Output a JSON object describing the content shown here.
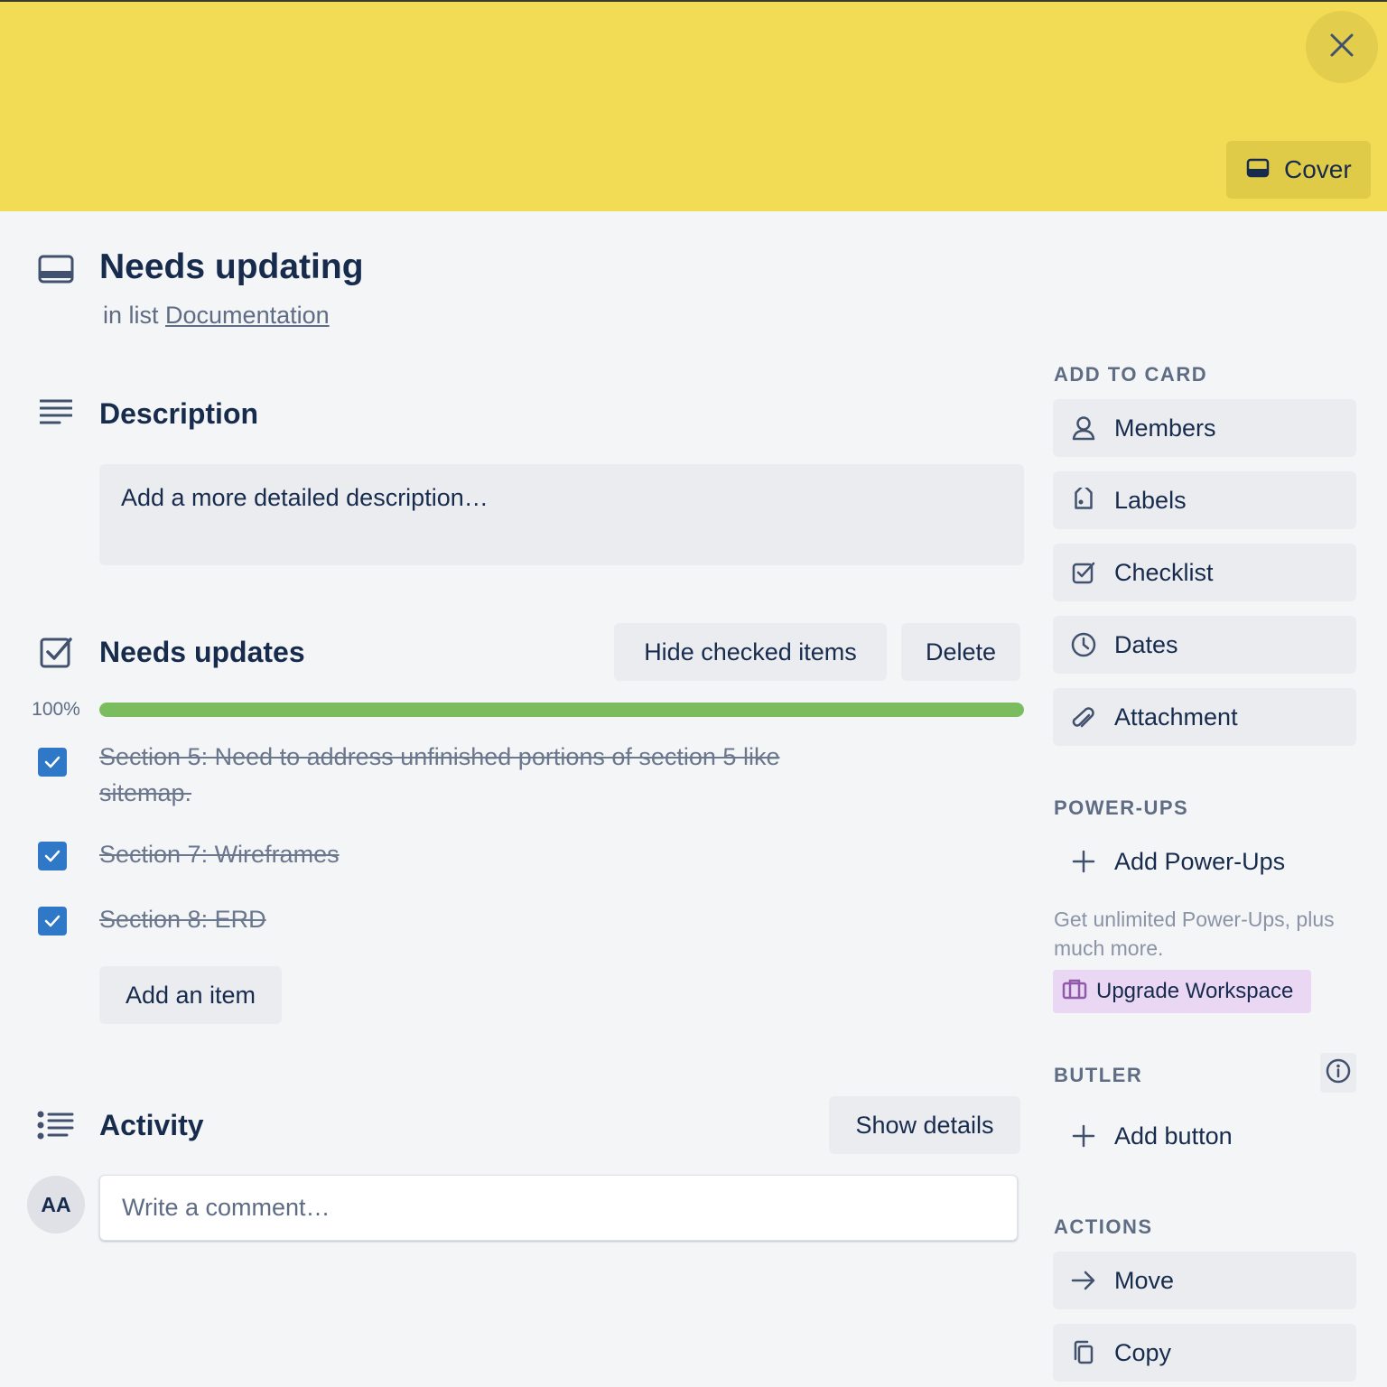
{
  "cover": {
    "color": "#f2dc55",
    "close_icon": "close-icon",
    "cover_button_label": "Cover"
  },
  "card": {
    "title": "Needs updating",
    "in_list_prefix": "in list",
    "list_name": "Documentation"
  },
  "description": {
    "heading": "Description",
    "placeholder": "Add a more detailed description…"
  },
  "checklist": {
    "title": "Needs updates",
    "hide_checked_label": "Hide checked items",
    "delete_label": "Delete",
    "progress_percent_label": "100%",
    "progress_fraction": 1.0,
    "progress_color": "#7bbd5e",
    "items": [
      {
        "text": "Section 5: Need to address unfinished portions of section 5 like sitemap.",
        "checked": true
      },
      {
        "text": "Section 7: Wireframes",
        "checked": true
      },
      {
        "text": "Section 8: ERD",
        "checked": true
      }
    ],
    "add_item_label": "Add an item"
  },
  "activity": {
    "heading": "Activity",
    "show_details_label": "Show details",
    "avatar_initials": "AA",
    "comment_placeholder": "Write a comment…"
  },
  "sidebar": {
    "add_to_card_title": "ADD TO CARD",
    "add_to_card": [
      {
        "label": "Members",
        "icon": "person-icon"
      },
      {
        "label": "Labels",
        "icon": "tag-icon"
      },
      {
        "label": "Checklist",
        "icon": "checkbox-icon"
      },
      {
        "label": "Dates",
        "icon": "clock-icon"
      },
      {
        "label": "Attachment",
        "icon": "paperclip-icon"
      }
    ],
    "power_ups_title": "POWER-UPS",
    "add_power_ups_label": "Add Power-Ups",
    "power_ups_note": "Get unlimited Power-Ups, plus much more.",
    "upgrade_label": "Upgrade Workspace",
    "upgrade_color": "#ead7f3",
    "butler_title": "BUTLER",
    "add_button_label": "Add button",
    "actions_title": "ACTIONS",
    "actions": [
      {
        "label": "Move",
        "icon": "arrow-right-icon"
      },
      {
        "label": "Copy",
        "icon": "copy-icon"
      }
    ]
  }
}
